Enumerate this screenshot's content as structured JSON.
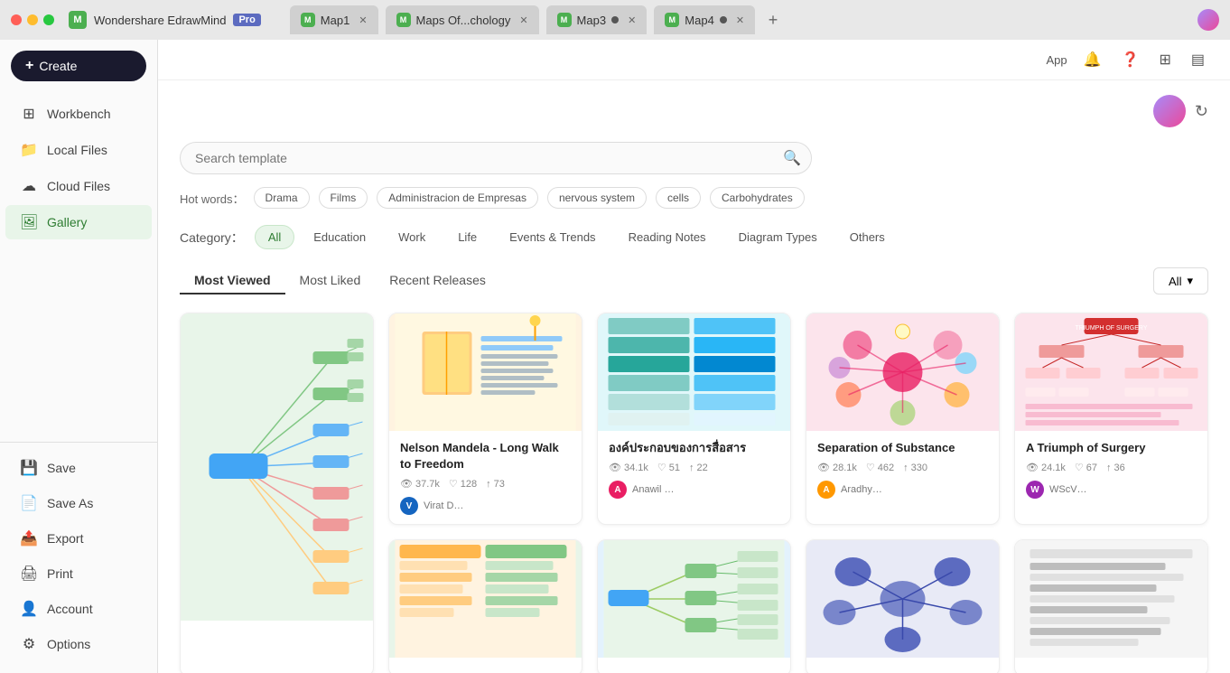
{
  "titlebar": {
    "app_name": "Wondershare EdrawMind",
    "pro_label": "Pro",
    "tabs": [
      {
        "id": "map1",
        "label": "Map1",
        "active": false,
        "dot": false
      },
      {
        "id": "maps-of-chology",
        "label": "Maps Of...chology",
        "active": false,
        "dot": false
      },
      {
        "id": "map3",
        "label": "Map3",
        "active": false,
        "dot": true
      },
      {
        "id": "map4",
        "label": "Map4",
        "active": false,
        "dot": true
      }
    ]
  },
  "topbar": {
    "app_label": "App",
    "icons": [
      "bell",
      "help",
      "grid",
      "layout"
    ]
  },
  "sidebar": {
    "create_label": "Create",
    "items": [
      {
        "id": "workbench",
        "label": "Workbench",
        "icon": "⊞"
      },
      {
        "id": "local-files",
        "label": "Local Files",
        "icon": "📁"
      },
      {
        "id": "cloud-files",
        "label": "Cloud Files",
        "icon": "☁"
      },
      {
        "id": "gallery",
        "label": "Gallery",
        "icon": "🖼",
        "active": true
      }
    ],
    "bottom_items": [
      {
        "id": "save",
        "label": "Save",
        "icon": "💾"
      },
      {
        "id": "save-as",
        "label": "Save As",
        "icon": "📄"
      },
      {
        "id": "export",
        "label": "Export",
        "icon": "📤"
      },
      {
        "id": "print",
        "label": "Print",
        "icon": "🖨"
      },
      {
        "id": "account",
        "label": "Account",
        "icon": "👤"
      },
      {
        "id": "options",
        "label": "Options",
        "icon": "⚙"
      }
    ]
  },
  "search": {
    "placeholder": "Search template",
    "hot_words_label": "Hot words：",
    "hot_tags": [
      "Drama",
      "Films",
      "Administracion de Empresas",
      "nervous system",
      "cells",
      "Carbohydrates"
    ]
  },
  "category": {
    "label": "Category：",
    "items": [
      "All",
      "Education",
      "Work",
      "Life",
      "Events & Trends",
      "Reading Notes",
      "Diagram Types",
      "Others"
    ],
    "active": "All"
  },
  "filter": {
    "tabs": [
      "Most Viewed",
      "Most Liked",
      "Recent Releases"
    ],
    "active": "Most Viewed",
    "dropdown_label": "All"
  },
  "cards": [
    {
      "id": "card1",
      "title": "",
      "views": "",
      "likes": "",
      "shares": "",
      "author": "",
      "author_color": "#4CAF50",
      "thumb_type": "tree-left",
      "thumb_bg": "#e8f5e9"
    },
    {
      "id": "card2",
      "title": "Nelson Mandela - Long Walk to Freedom",
      "views": "37.7k",
      "likes": "128",
      "shares": "73",
      "author": "Virat D…",
      "author_initial": "V",
      "author_color": "#1565C0",
      "thumb_type": "book-notes",
      "thumb_bg": "#fff8e1"
    },
    {
      "id": "card3",
      "title": "องค์ประกอบของการสื่อสาร",
      "views": "34.1k",
      "likes": "51",
      "shares": "22",
      "author": "Anawil …",
      "author_initial": "A",
      "author_color": "#e91e63",
      "thumb_type": "colorblocks",
      "thumb_bg": "#e0f7fa"
    },
    {
      "id": "card4",
      "title": "Separation of Substance",
      "views": "28.1k",
      "likes": "462",
      "shares": "330",
      "author": "Aradhy…",
      "author_initial": "A",
      "author_color": "#ff9800",
      "thumb_type": "circles",
      "thumb_bg": "#fce4ec"
    },
    {
      "id": "card5",
      "title": "A Triumph of Surgery",
      "views": "24.1k",
      "likes": "67",
      "shares": "36",
      "author": "WScV…",
      "author_initial": "W",
      "author_color": "#9c27b0",
      "thumb_type": "hierarchy",
      "thumb_bg": "#fce4ec"
    },
    {
      "id": "card6",
      "title": "",
      "views": "",
      "likes": "",
      "shares": "",
      "author": "",
      "thumb_type": "mindmap2",
      "thumb_bg": "#e8f5e9"
    },
    {
      "id": "card7",
      "title": "",
      "views": "",
      "likes": "",
      "shares": "",
      "author": "",
      "thumb_type": "tree2",
      "thumb_bg": "#e3f2fd"
    },
    {
      "id": "card8",
      "title": "",
      "views": "",
      "likes": "",
      "shares": "",
      "author": "",
      "thumb_type": "clusters",
      "thumb_bg": "#e8eaf6"
    },
    {
      "id": "card9",
      "title": "",
      "views": "",
      "likes": "",
      "shares": "",
      "author": "",
      "thumb_type": "lines",
      "thumb_bg": "#f5f5f5"
    }
  ]
}
